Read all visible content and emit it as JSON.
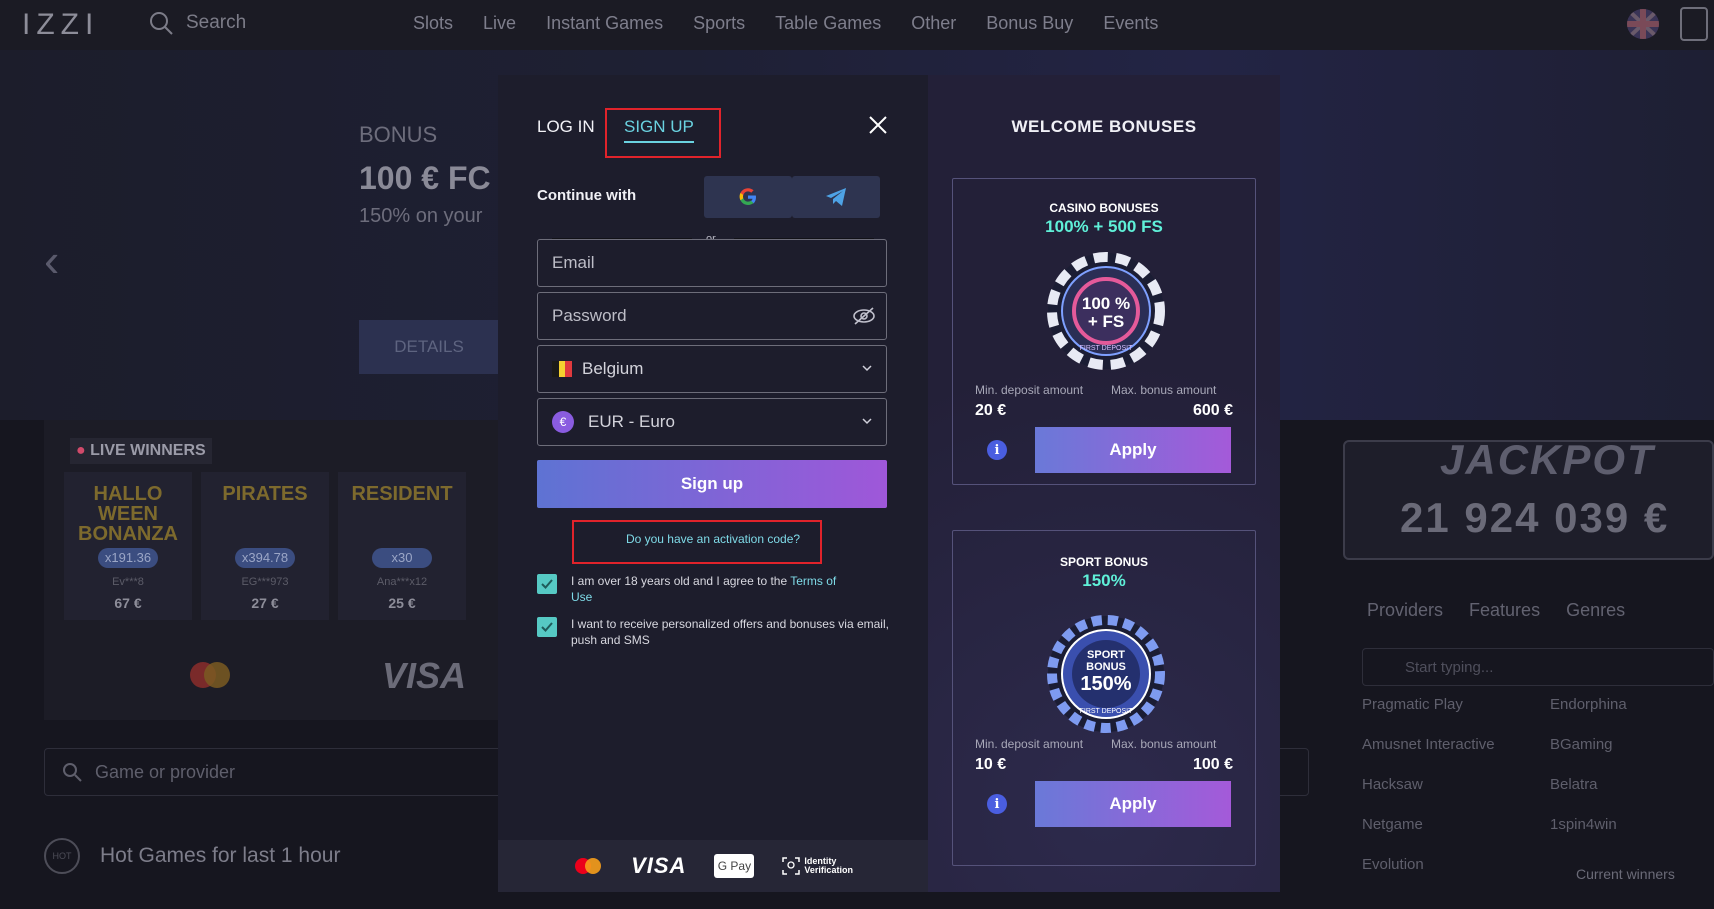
{
  "topbar": {
    "logo": "IZZI",
    "search_label": "Search",
    "nav": [
      "Slots",
      "Live",
      "Instant Games",
      "Sports",
      "Table Games",
      "Other",
      "Bonus Buy",
      "Events"
    ]
  },
  "hero": {
    "label": "BONUS",
    "title": "100 € FC",
    "subtitle": "150% on your",
    "details_button": "DETAILS"
  },
  "live_winners": {
    "title": "LIVE WINNERS",
    "cards": [
      {
        "game": "HALLO WEEN BONANZA",
        "multiplier": "x191.36",
        "user": "Ev***8",
        "amount": "67 €"
      },
      {
        "game": "PIRATES",
        "multiplier": "x394.78",
        "user": "EG***973",
        "amount": "27 €"
      },
      {
        "game": "RESIDENT",
        "multiplier": "x30",
        "user": "Ana***x12",
        "amount": "25 €"
      }
    ],
    "visa": "VISA"
  },
  "game_search": {
    "placeholder": "Game or provider"
  },
  "hot_games": {
    "label": "Hot Games for last 1 hour",
    "icon_text": "HOT"
  },
  "jackpot": {
    "label": "JACKPOT",
    "amount": "21 924 039 €"
  },
  "providers": {
    "tabs": [
      "Providers",
      "Features",
      "Genres"
    ],
    "search_placeholder": "Start typing...",
    "left": [
      "Pragmatic Play",
      "Amusnet Interactive",
      "Hacksaw",
      "Netgame",
      "Evolution"
    ],
    "right": [
      "Endorphina",
      "BGaming",
      "Belatra",
      "1spin4win"
    ]
  },
  "current_winners": "Current winners",
  "modal": {
    "tab_login": "LOG IN",
    "tab_signup": "SIGN UP",
    "continue_with": "Continue with",
    "or": "or",
    "email_placeholder": "Email",
    "password_placeholder": "Password",
    "country": "Belgium",
    "currency": "EUR - Euro",
    "currency_symbol": "€",
    "signup_button": "Sign up",
    "activation_link": "Do you have an activation code?",
    "terms_prefix": "I am over 18 years old and I agree to the ",
    "terms_link_1": "Terms of",
    "terms_link_2": "Use",
    "offers_text": "I want to receive personalized offers and bonuses via email, push and SMS",
    "payments": {
      "visa": "VISA",
      "gpay": "G Pay",
      "id_top": "Identity",
      "id_bottom": "Verification"
    }
  },
  "bonuses": {
    "title": "WELCOME BONUSES",
    "casino": {
      "title": "CASINO BONUSES",
      "value": "100% + 500 FS",
      "chip_line1": "100 %",
      "chip_line2": "+ FS",
      "chip_ring": "FIRST DEPOSIT",
      "min_label": "Min. deposit amount",
      "max_label": "Max. bonus amount",
      "min_value": "20 €",
      "max_value": "600 €",
      "apply": "Apply"
    },
    "sport": {
      "title": "SPORT BONUS",
      "value": "150%",
      "chip_line1": "SPORT",
      "chip_line2": "BONUS",
      "chip_line3": "150%",
      "chip_ring": "FIRST DEPOSIT",
      "min_label": "Min. deposit amount",
      "max_label": "Max. bonus amount",
      "min_value": "10 €",
      "max_value": "100 €",
      "apply": "Apply"
    }
  },
  "colors": {
    "accent_teal": "#6ad2e0",
    "highlight_red": "#e0232b",
    "button_gradient_start": "#5e73d3",
    "button_gradient_end": "#9f57d9",
    "bonus_value": "#5ff0d8"
  }
}
